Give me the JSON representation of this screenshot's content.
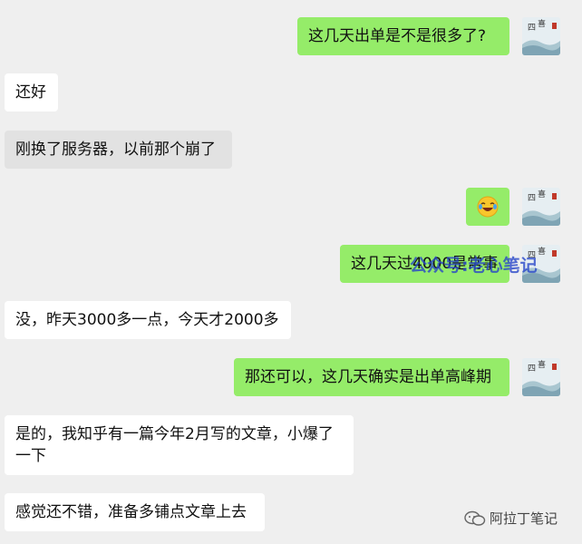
{
  "messages": [
    {
      "side": "right",
      "text": "这几天出单是不是很多了?"
    },
    {
      "side": "left",
      "text": "还好"
    },
    {
      "side": "left",
      "text": "刚换了服务器，以前那个崩了"
    },
    {
      "side": "right",
      "emoji": "laughing-crying-emoji"
    },
    {
      "side": "right",
      "text": "这几天过4000是常事"
    },
    {
      "side": "left",
      "text": "没，昨天3000多一点，今天才2000多"
    },
    {
      "side": "right",
      "text": "那还可以，这几天确实是出单高峰期"
    },
    {
      "side": "left",
      "text": "是的，我知乎有一篇今年2月写的文章，小爆了一下"
    },
    {
      "side": "left",
      "text": "感觉还不错，准备多铺点文章上去"
    }
  ],
  "avatar": {
    "seal_text": "四喜"
  },
  "watermarks": {
    "overlay": "公众号:老心笔记",
    "footer": "阿拉丁笔记"
  },
  "colors": {
    "background": "#efefef",
    "bubble_right": "#95ec69",
    "bubble_left": "#ffffff",
    "bubble_left_gray": "#e2e2e2",
    "watermark_blue": "#2846c8"
  }
}
